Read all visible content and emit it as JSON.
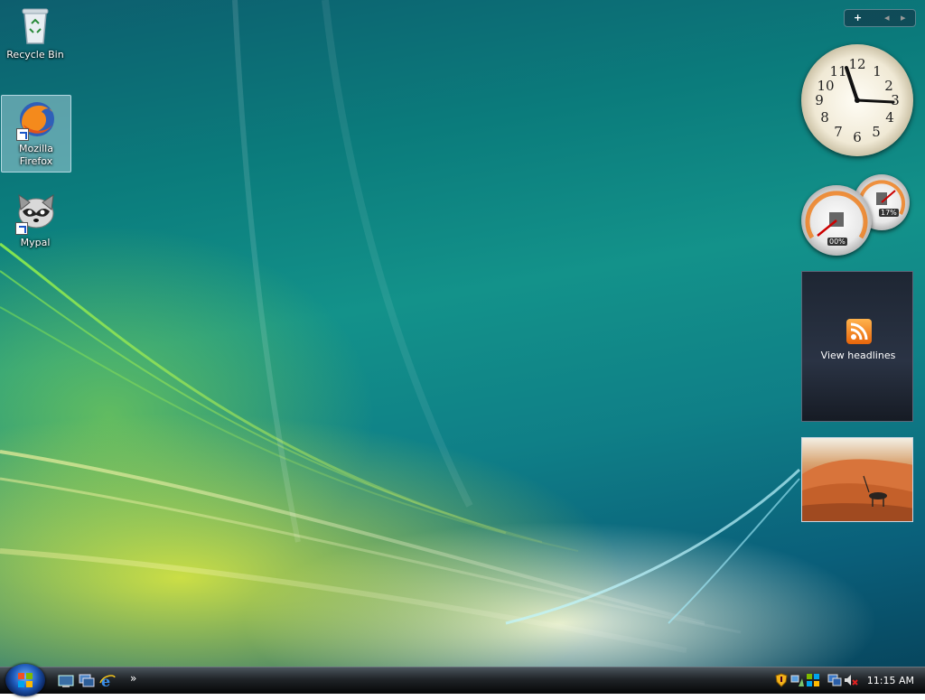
{
  "desktop_icons": [
    {
      "label": "Recycle Bin",
      "icon": "recycle-bin-icon"
    },
    {
      "label": "Mozilla Firefox",
      "icon": "firefox-icon",
      "shortcut": true,
      "selected": true
    },
    {
      "label": "Mypal",
      "icon": "mypal-icon",
      "shortcut": true
    }
  ],
  "sidebar": {
    "controls": {
      "add": "+",
      "prev": "◂",
      "next": "▸"
    },
    "clock": {
      "numbers": [
        "12",
        "1",
        "2",
        "3",
        "4",
        "5",
        "6",
        "7",
        "8",
        "9",
        "10",
        "11"
      ]
    },
    "cpu_meter": {
      "cpu": "00%",
      "memory": "17%"
    },
    "feed": {
      "label": "View headlines"
    },
    "slideshow": {
      "icon": "oryx-desert-photo"
    }
  },
  "taskbar": {
    "start_icon": "windows-start-orb",
    "quick_launch": [
      "show-desktop-icon",
      "switch-windows-icon",
      "internet-explorer-icon"
    ],
    "chevron": "»",
    "tray_icons": [
      "security-shield-icon",
      "network-icon",
      "windows-update-icon",
      "display-icon",
      "volume-muted-icon"
    ],
    "time": "11:15 AM"
  },
  "colors": {
    "accent": "#1d58b8",
    "rss": "#f07b14"
  }
}
